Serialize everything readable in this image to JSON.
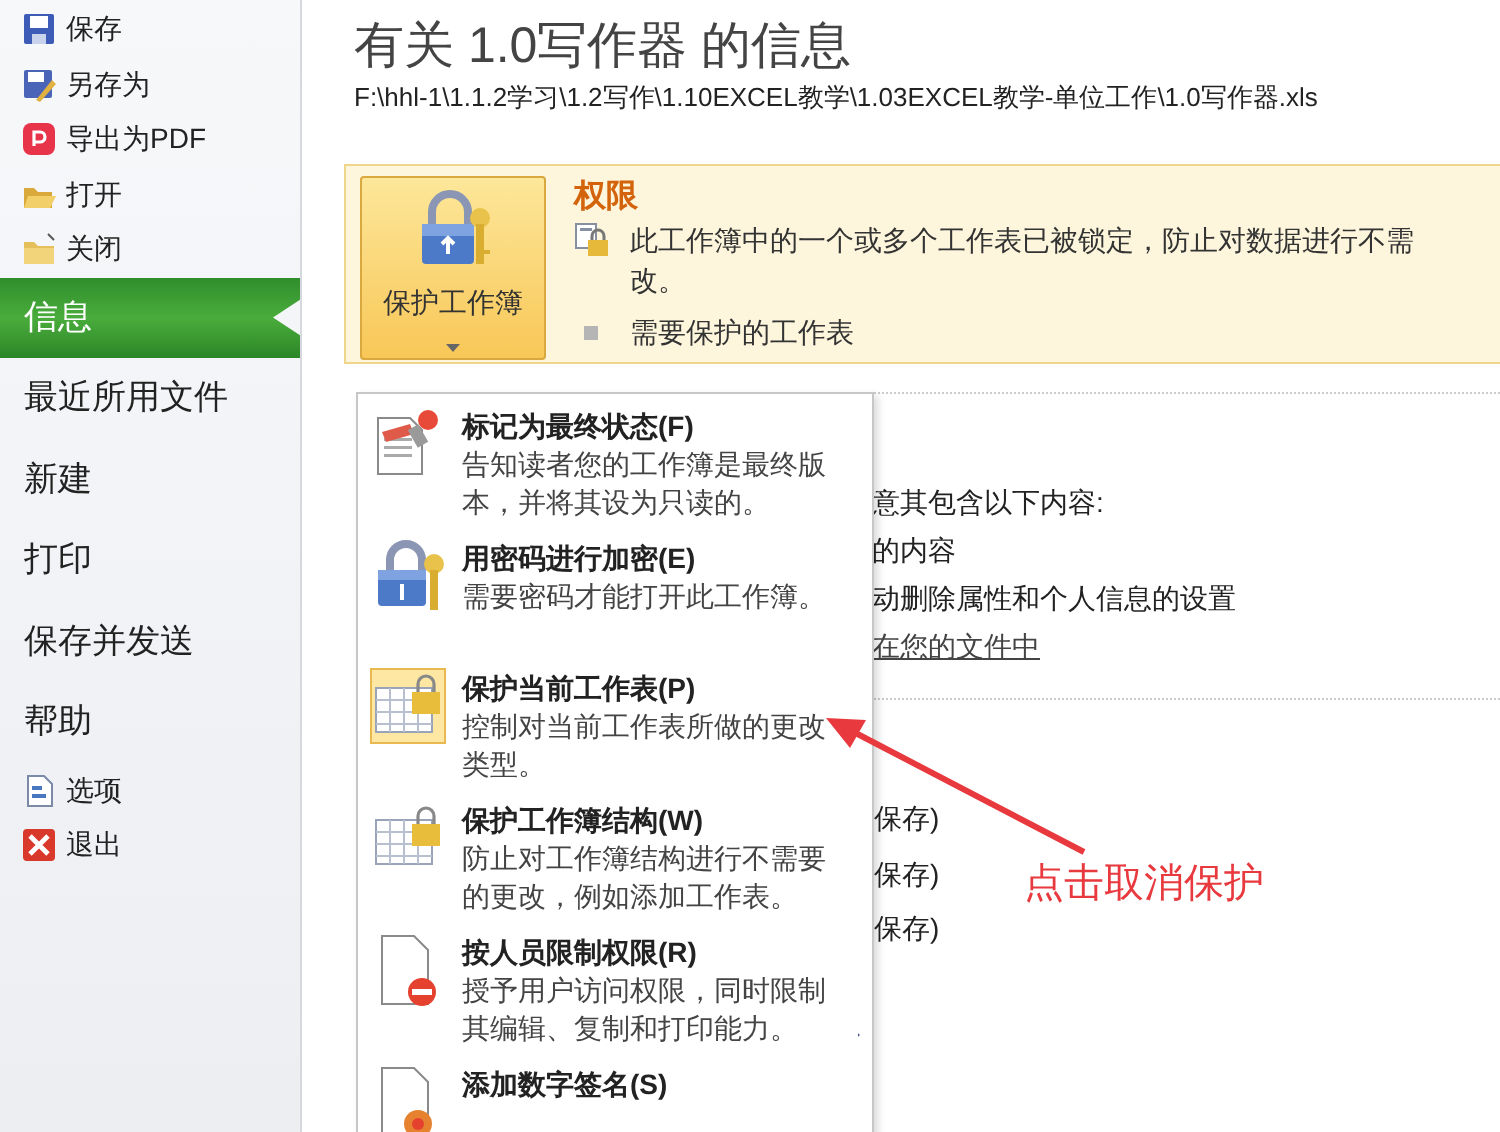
{
  "sidebar": {
    "items": [
      {
        "kind": "command",
        "label": "保存",
        "selected": false
      },
      {
        "kind": "command",
        "label": "另存为",
        "selected": false
      },
      {
        "kind": "command",
        "label": "导出为PDF",
        "selected": false
      },
      {
        "kind": "command",
        "label": "打开",
        "selected": false
      },
      {
        "kind": "command",
        "label": "关闭",
        "selected": false
      },
      {
        "kind": "tab",
        "label": "信息",
        "selected": true
      },
      {
        "kind": "tab",
        "label": "最近所用文件",
        "selected": false
      },
      {
        "kind": "tab",
        "label": "新建",
        "selected": false
      },
      {
        "kind": "tab",
        "label": "打印",
        "selected": false
      },
      {
        "kind": "tab",
        "label": "保存并发送",
        "selected": false
      },
      {
        "kind": "tab",
        "label": "帮助",
        "selected": false
      },
      {
        "kind": "command",
        "label": "选项",
        "selected": false
      },
      {
        "kind": "command",
        "label": "退出",
        "selected": false
      }
    ]
  },
  "title": "有关 1.0写作器 的信息",
  "path": "F:\\hhl-1\\1.1.2学习\\1.2写作\\1.10EXCEL教学\\1.03EXCEL教学-单位工作\\1.0写作器.xls",
  "permissions": {
    "button": {
      "label": "保护工作簿",
      "expanded": true
    },
    "heading": "权限",
    "lines": [
      "此工作簿中的一个或多个工作表已被锁定，防止对数据进行不需",
      "改。"
    ],
    "bullet": "需要保护的工作表"
  },
  "menu": {
    "items": [
      {
        "title": "标记为最终状态(F)",
        "description": "告知读者您的工作簿是最终版本，并将其设为只读的。",
        "highlighted": false,
        "submenu": false
      },
      {
        "title": "用密码进行加密(E)",
        "description": "需要密码才能打开此工作簿。",
        "highlighted": false,
        "submenu": false
      },
      {
        "title": "保护当前工作表(P)",
        "description": "控制对当前工作表所做的更改类型。",
        "highlighted": true,
        "submenu": false
      },
      {
        "title": "保护工作簿结构(W)",
        "description": "防止对工作簿结构进行不需要的更改，例如添加工作表。",
        "highlighted": false,
        "submenu": false
      },
      {
        "title": "按人员限制权限(R)",
        "description": "授予用户访问权限，同时限制其编辑、复制和打印能力。",
        "highlighted": false,
        "submenu": true
      },
      {
        "title": "添加数字签名(S)",
        "highlighted": false,
        "submenu": false
      }
    ]
  },
  "section_2": {
    "lines": [
      {
        "kind": "text",
        "text": "意其包含以下内容:"
      },
      {
        "kind": "text",
        "text": "的内容"
      },
      {
        "kind": "text",
        "text": "动删除属性和个人信息的设置"
      },
      {
        "kind": "link",
        "text": "在您的文件中"
      }
    ]
  },
  "section_3": {
    "lines": [
      "保存)",
      "保存)",
      "保存)"
    ]
  },
  "annotation": {
    "text": "点击取消保护"
  }
}
